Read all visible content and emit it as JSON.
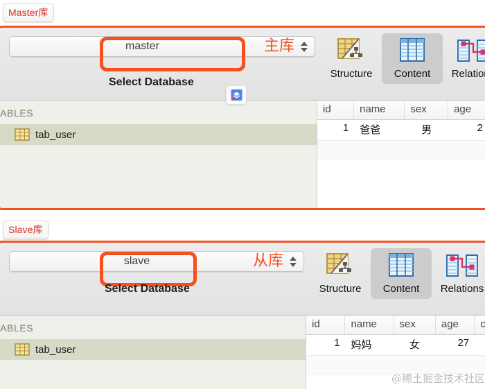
{
  "annotations": {
    "master_badge": "Master库",
    "slave_badge": "Slave库"
  },
  "panels": [
    {
      "id": "master",
      "db_value": "master",
      "db_annotation": "主库",
      "select_caption": "Select Database",
      "stepper_icon": "chevron-up-down-icon",
      "mini_icon": "sequelpro-app-icon",
      "toolbar_items": [
        {
          "label": "Structure",
          "icon": "structure-icon",
          "selected": false
        },
        {
          "label": "Content",
          "icon": "content-table-icon",
          "selected": true
        },
        {
          "label": "Relations",
          "icon": "relations-icon",
          "selected": false
        }
      ],
      "sidebar": {
        "header": "TABLES",
        "tables": [
          {
            "name": "tab_user",
            "icon": "table-icon",
            "selected": true
          }
        ]
      },
      "grid": {
        "columns": [
          "id",
          "name",
          "sex",
          "age"
        ],
        "rows": [
          [
            "1",
            "爸爸",
            "男",
            "2"
          ]
        ]
      }
    },
    {
      "id": "slave",
      "db_value": "slave",
      "db_annotation": "从库",
      "select_caption": "Select Database",
      "stepper_icon": "chevron-up-down-icon",
      "mini_icon": null,
      "toolbar_items": [
        {
          "label": "Structure",
          "icon": "structure-icon",
          "selected": false
        },
        {
          "label": "Content",
          "icon": "content-table-icon",
          "selected": true
        },
        {
          "label": "Relations",
          "icon": "relations-icon",
          "selected": false
        }
      ],
      "sidebar": {
        "header": "TABLES",
        "tables": [
          {
            "name": "tab_user",
            "icon": "table-icon",
            "selected": true
          }
        ]
      },
      "grid": {
        "columns": [
          "id",
          "name",
          "sex",
          "age",
          "c"
        ],
        "rows": [
          [
            "1",
            "妈妈",
            "女",
            "27",
            ""
          ]
        ]
      }
    }
  ],
  "watermark": "@稀土掘金技术社区",
  "colors": {
    "annotation_red": "#f4511e",
    "badge_text": "#d93025",
    "selected_tab_bg": "#cccccc",
    "sidebar_bg": "#eef1ea",
    "sidebar_selected": "#d6dbc8"
  }
}
